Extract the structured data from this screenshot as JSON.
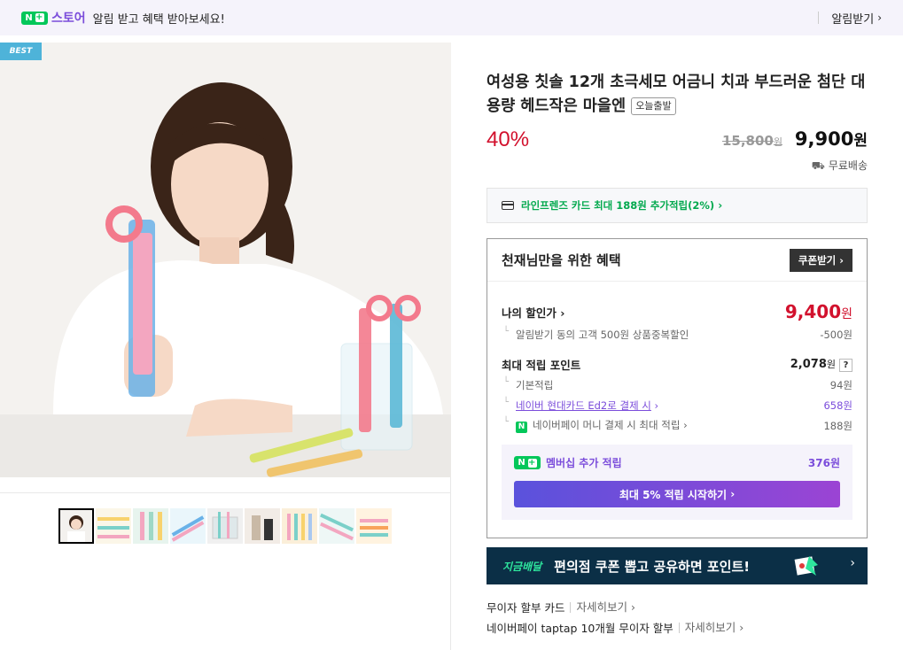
{
  "banner": {
    "logo_badge": "N",
    "store_label": "스토어",
    "message": "알림 받고 혜택 받아보세요!",
    "subscribe_label": "알림받기"
  },
  "gallery": {
    "best_tag": "BEST",
    "thumbnail_count": 9,
    "selected_index": 0
  },
  "product": {
    "title": "여성용 칫솔 12개 초극세모 어금니 치과 부드러운 첨단 대용량 헤드작은 마을엔",
    "dispatch_badge": "오늘출발",
    "discount": "40%",
    "original_price": "15,800",
    "original_unit": "원",
    "sale_price": "9,900",
    "sale_unit": "원",
    "shipping": "무료배송"
  },
  "card_promo": {
    "text": "라인프렌즈 카드 최대 188원 추가적립(2%)"
  },
  "benefit": {
    "title": "천재님만을 위한 혜택",
    "coupon_button": "쿠폰받기",
    "my_price_label": "나의 할인가",
    "my_price": "9,400",
    "my_price_unit": "원",
    "discount_note": "알림받기 동의 고객 500원 상품중복할인",
    "discount_amount": "-500원",
    "points_label": "최대 적립 포인트",
    "points_total": "2,078",
    "points_unit": "원",
    "help": "?",
    "point_rows": [
      {
        "label": "기본적립",
        "value": "94원"
      },
      {
        "label": "네이버 현대카드 Ed2로 결제 시",
        "value": "658원"
      },
      {
        "label": "네이버페이 머니 결제 시 최대 적립",
        "value": "188원"
      }
    ],
    "membership_label": "멤버십 추가 적립",
    "membership_value": "376원",
    "membership_button": "최대 5% 적립 시작하기"
  },
  "ad": {
    "logo": "지금배달",
    "text": "편의점 쿠폰 뽑고 공유하면 포인트!"
  },
  "links": [
    {
      "label": "무이자 할부 카드",
      "more": "자세히보기"
    },
    {
      "label": "네이버페이 taptap 10개월 무이자 할부",
      "more": "자세히보기"
    }
  ],
  "colors": {
    "accent_red": "#d2112d",
    "naver_green": "#03c75a",
    "purple": "#7b4ddb",
    "best_tag": "#4eb3d9",
    "ad_bg": "#0b2f46"
  }
}
